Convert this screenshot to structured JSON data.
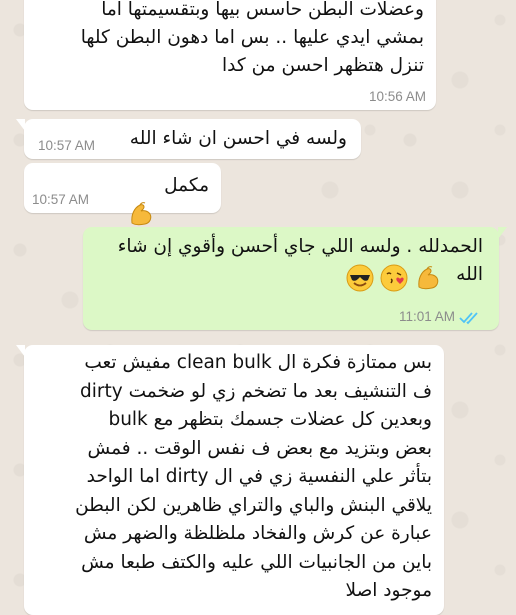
{
  "messages": [
    {
      "id": "m1",
      "direction": "incoming",
      "text": "وعضلات البطن حاسس بيها وبتقسيمتها اما\nبمشي ايدي عليها .. بس اما دهون البطن كلها\nتنزل هتظهر احسن من كدا",
      "time": "10:56 AM"
    },
    {
      "id": "m2",
      "direction": "incoming",
      "text": "ولسه في احسن ان شاء الله",
      "time": "10:57 AM"
    },
    {
      "id": "m3",
      "direction": "incoming",
      "text": "مكمل",
      "emoji": "flexed-biceps",
      "time": "10:57 AM"
    },
    {
      "id": "m4",
      "direction": "outgoing",
      "text": "الحمدلله . ولسه اللي جاي أحسن وأقوي إن شاء\nالله",
      "emojis": [
        "flexed-biceps",
        "face-blowing-kiss",
        "smiling-face-with-sunglasses"
      ],
      "time": "11:01 AM",
      "status": "read"
    },
    {
      "id": "m5",
      "direction": "incoming",
      "text": "بس ممتازة فكرة ال clean bulk مفيش تعب\nف التنشيف بعد ما تضخم زي لو ضخمت dirty\nbulk وبعدين كل عضلات جسمك بتظهر مع\nبعض وبتزيد مع بعض ف نفس الوقت .. فمش\nبتأثر علي النفسية زي في ال dirty اما الواحد\nيلاقي البنش والباي والتراي ظاهرين لكن البطن\nعبارة عن كرش والفخاد ملظلظة والضهر مش\nباين من الجانبيات اللي عليه والكتف طبعا مش\nموجود اصلا"
    }
  ],
  "colors": {
    "wallpaper": "#ece5dd",
    "incoming_bubble": "#ffffff",
    "outgoing_bubble": "#dcf8c6",
    "time_text": "#8c8c8c",
    "read_ticks": "#4fc3f7"
  }
}
